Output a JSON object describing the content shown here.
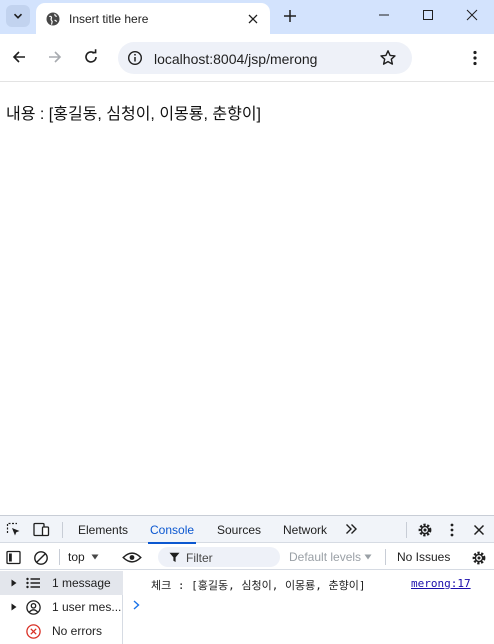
{
  "browser": {
    "tab": {
      "title": "Insert title here"
    },
    "address": {
      "url": "localhost:8004/jsp/merong"
    }
  },
  "page": {
    "content_text": "내용 : [홍길동, 심청이, 이몽룡, 춘향이]"
  },
  "devtools": {
    "tabs": [
      "Elements",
      "Console",
      "Sources",
      "Network"
    ],
    "active_tab": "Console",
    "context": "top",
    "filter_placeholder": "Filter",
    "levels": "Default levels",
    "issues": "No Issues",
    "sidebar": [
      {
        "label": "1 message",
        "icon": "list-icon"
      },
      {
        "label": "1 user mes...",
        "icon": "user-icon"
      },
      {
        "label": "No errors",
        "icon": "error-icon"
      }
    ],
    "log": {
      "message": "체크 : [홍길동, 심청이, 이몽룡, 춘향이]",
      "source": "merong:17"
    }
  },
  "colors": {
    "tabstrip": "#d3e3fd",
    "accent": "#0b57d0",
    "error": "#d93025",
    "link": "#1a0dab"
  }
}
